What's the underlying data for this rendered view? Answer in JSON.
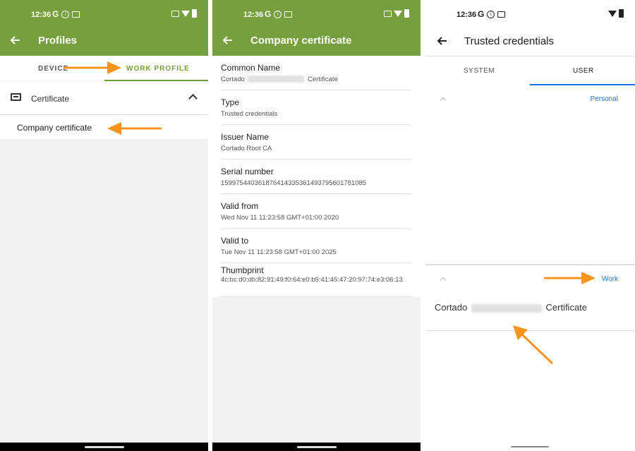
{
  "status": {
    "time": "12:36"
  },
  "panel1": {
    "title": "Profiles",
    "tabs": [
      {
        "label": "DEVICE"
      },
      {
        "label": "WORK PROFILE"
      }
    ],
    "section_label": "Certificate",
    "item_label": "Company certificate"
  },
  "panel2": {
    "title": "Company certificate",
    "fields": [
      {
        "label": "Common Name",
        "value_prefix": "Cortado",
        "value_suffix": "Certificate"
      },
      {
        "label": "Type",
        "value": "Trusted credentials"
      },
      {
        "label": "Issuer Name",
        "value": "Cortado Root CA"
      },
      {
        "label": "Serial number",
        "value": "159975440361876414335361493795601781085"
      },
      {
        "label": "Valid from",
        "value": "Wed Nov 11 11:23:58 GMT+01:00 2020"
      },
      {
        "label": "Valid to",
        "value": "Tue Nov 11 11:23:58 GMT+01:00 2025"
      },
      {
        "label": "Thumbprint",
        "value": "4c:bc:d0:db:82:91:49:f0:64:e0:b5:41:45:47:20:97:74:e3:06:13"
      }
    ]
  },
  "panel3": {
    "title": "Trusted credentials",
    "tabs": [
      {
        "label": "SYSTEM"
      },
      {
        "label": "USER"
      }
    ],
    "personal_label": "Personal",
    "work_label": "Work",
    "credential_prefix": "Cortado",
    "credential_suffix": "Certificate"
  },
  "colors": {
    "app_green": "#76a03e",
    "link_blue": "#1a73e8",
    "annotation_orange": "#f7931e"
  }
}
